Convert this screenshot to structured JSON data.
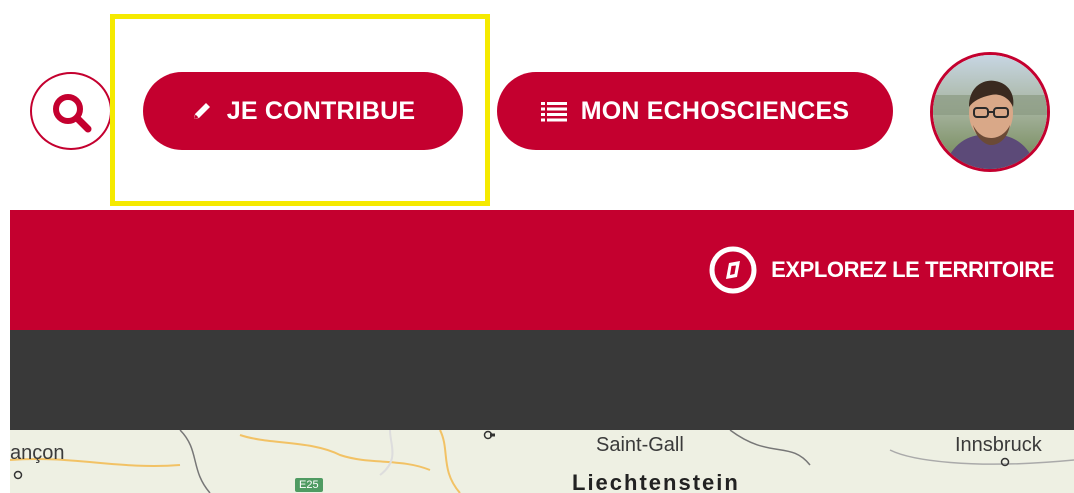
{
  "header": {
    "contribute_label": "JE CONTRIBUE",
    "echosciences_label": "MON ECHOSCIENCES"
  },
  "nav": {
    "explore_label": "EXPLOREZ LE TERRITOIRE"
  },
  "map": {
    "labels": {
      "besancon": "ançon",
      "saint_gall": "Saint-Gall",
      "innsbruck": "Innsbruck",
      "liechtenstein": "Liechtenstein",
      "road": "E25"
    }
  },
  "colors": {
    "brand_red": "#c4002f",
    "dark_bar": "#393939",
    "highlight": "#f5ea00"
  },
  "icons": {
    "search": "search-icon",
    "contribute": "pencil-icon",
    "echosciences": "list-icon",
    "explore": "compass-icon"
  }
}
